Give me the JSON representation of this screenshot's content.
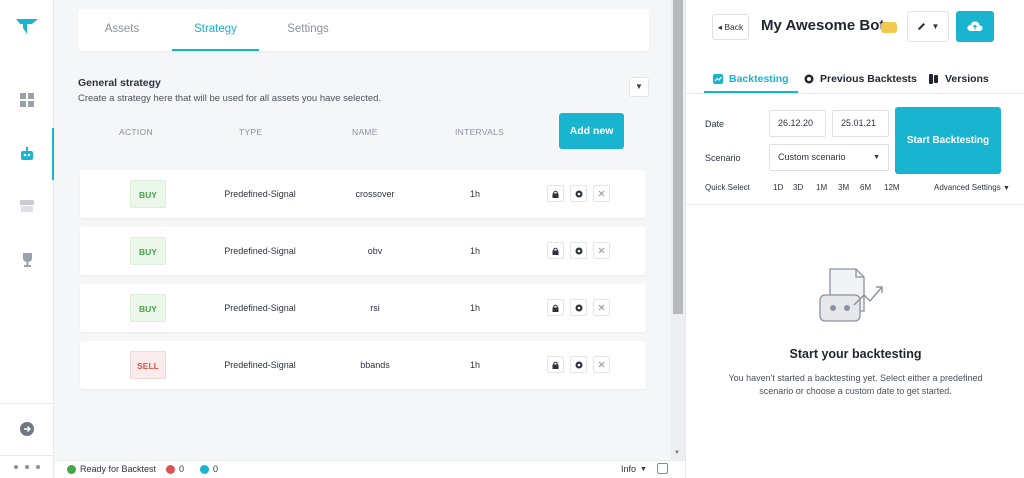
{
  "main": {
    "tabs": [
      {
        "label": "Assets"
      },
      {
        "label": "Strategy"
      },
      {
        "label": "Settings"
      }
    ],
    "general_strategy": {
      "title": "General strategy",
      "description": "Create a strategy here that will be used for all assets you have selected."
    },
    "columns": {
      "action": "ACTION",
      "type": "TYPE",
      "name": "NAME",
      "intervals": "INTERVALS"
    },
    "add_new_label": "Add new",
    "rows": [
      {
        "action": "BUY",
        "type": "Predefined-Signal",
        "name": "crossover",
        "interval": "1h"
      },
      {
        "action": "BUY",
        "type": "Predefined-Signal",
        "name": "obv",
        "interval": "1h"
      },
      {
        "action": "BUY",
        "type": "Predefined-Signal",
        "name": "rsi",
        "interval": "1h"
      },
      {
        "action": "SELL",
        "type": "Predefined-Signal",
        "name": "bbands",
        "interval": "1h"
      }
    ]
  },
  "status": {
    "ready": "Ready for Backtest",
    "errors": "0",
    "infos": "0",
    "level": "Info"
  },
  "right": {
    "back_label": "Back",
    "bot_name": "My Awesome Bot",
    "tabs": [
      {
        "label": "Backtesting"
      },
      {
        "label": "Previous Backtests"
      },
      {
        "label": "Versions"
      }
    ],
    "date_label": "Date",
    "date_from": "26.12.20",
    "date_to": "25.01.21",
    "scenario_label": "Scenario",
    "scenario_value": "Custom scenario",
    "start_label": "Start Backtesting",
    "quick_select_label": "Quick Select",
    "quick_options": [
      "1D",
      "3D",
      "1M",
      "3M",
      "6M",
      "12M"
    ],
    "advanced_label": "Advanced Settings",
    "empty_title": "Start your backtesting",
    "empty_desc": "You haven't started a backtesting yet. Select either a predefined scenario or choose a custom date to get started."
  },
  "colors": {
    "accent": "#19b4cf",
    "buy": "#47a447",
    "sell": "#d9534f"
  }
}
